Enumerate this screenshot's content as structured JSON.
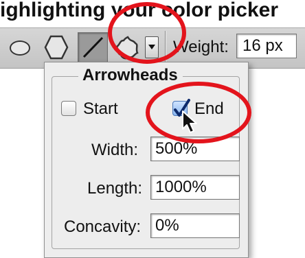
{
  "heading": "ighlighting your color picker",
  "toolbar": {
    "tools": [
      "ellipse-tool",
      "polygon-tool",
      "line-tool",
      "custom-shape-tool"
    ],
    "weight_label": "Weight:",
    "weight_value": "16 px"
  },
  "arrowheads": {
    "title": "Arrowheads",
    "start_label": "Start",
    "start_checked": false,
    "end_label": "End",
    "end_checked": true,
    "width_label": "Width:",
    "width_value": "500%",
    "length_label": "Length:",
    "length_value": "1000%",
    "concavity_label": "Concavity:",
    "concavity_value": "0%"
  },
  "colors": {
    "highlight": "#e3141c",
    "panel": "#ededed",
    "bar": "#cccccc"
  }
}
